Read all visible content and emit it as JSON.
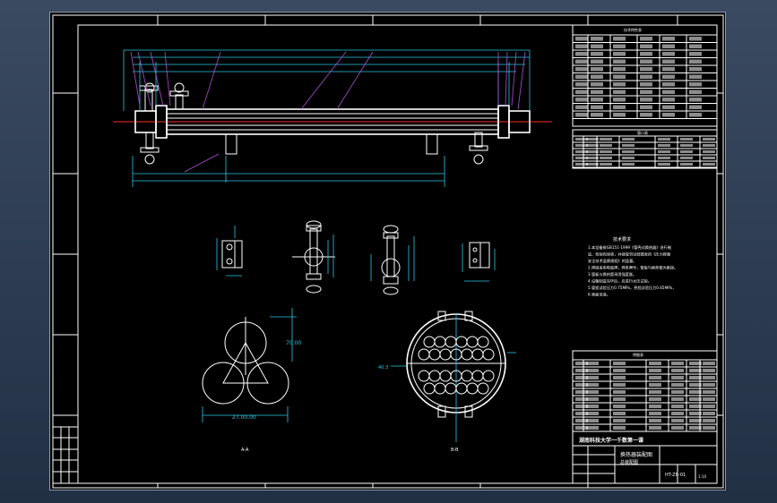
{
  "drawing": {
    "title_block": {
      "school": "湖南科技大学一千数第一课",
      "drawing_title_line1": "换热器装配图",
      "drawing_title_line2": "总装配图",
      "drawing_number": "HT-ZB-01",
      "scale": "1:10"
    },
    "section_a_label": "A-A",
    "section_b_label": "B-B",
    "tech_requirements_title": "技术要求",
    "tech_requirements": [
      "1.本设备按GB151-1999《管壳式换热器》进行制",
      "造、检验和验收，并接受劳动部颁发的《压力容器",
      "安全技术监察规程》的监督。",
      "2.焊接采用电弧焊，焊条牌号，管板与换热管为胀接。",
      "3.管板与换热管采用强度胀。",
      "4.设备制造完毕后，应进行水压试验。",
      "5.管程试验压力0.75MPa，壳程试验压力0.65MPa，",
      "6.表面涂漆。"
    ],
    "dim_triangle_pitch": "70.00",
    "dim_triangle_width": "27.00.00",
    "dim_tubesheet_gap": "40.3",
    "top_table_header": "技术特性表",
    "nozzle_table_header": "管口表",
    "parts_list_header": "明细表"
  },
  "colors": {
    "background": "#000000",
    "linework": "#ffffff",
    "dimension": "#29c9e6",
    "leader": "#b04fd6",
    "centerline": "#ff2a2a"
  }
}
